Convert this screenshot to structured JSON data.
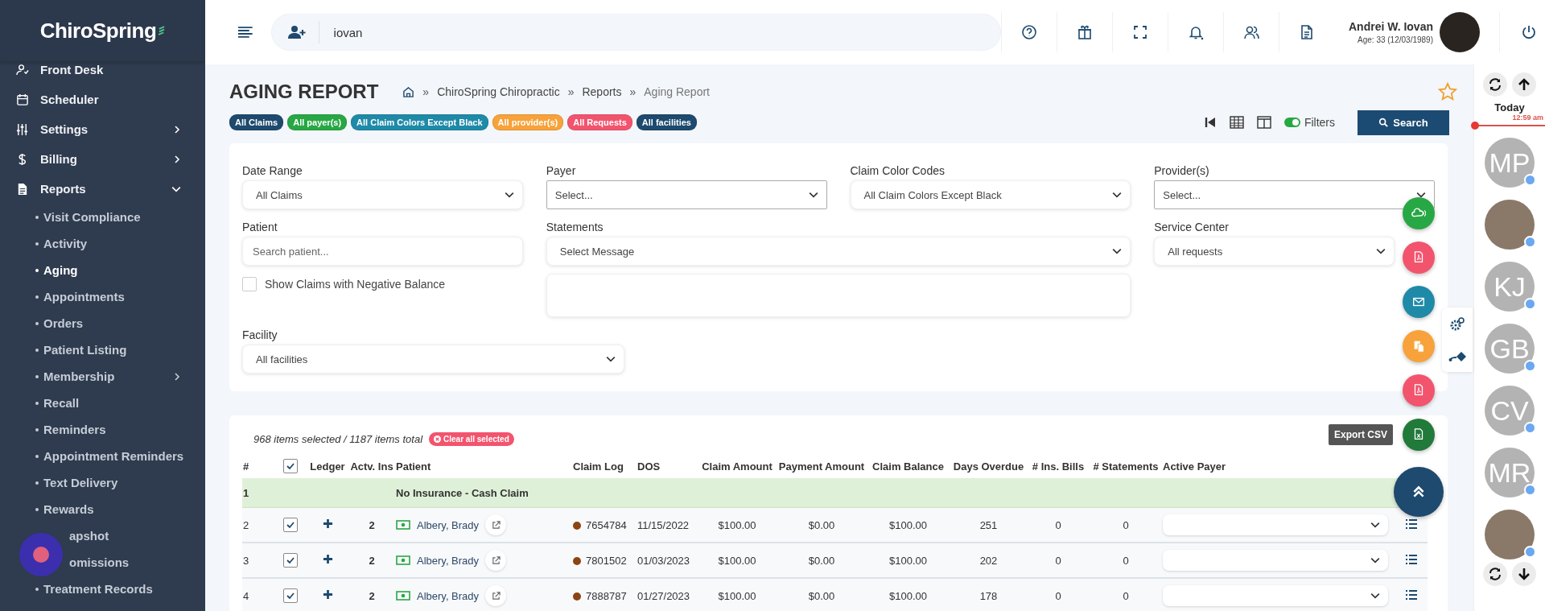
{
  "sidebar": {
    "logo": "ChiroSpring",
    "items": [
      {
        "label": "Front Desk"
      },
      {
        "label": "Scheduler"
      },
      {
        "label": "Settings",
        "expanded": false
      },
      {
        "label": "Billing",
        "expanded": false
      },
      {
        "label": "Reports",
        "expanded": true,
        "children": [
          {
            "label": "Visit Compliance",
            "selected": false,
            "covered": false
          },
          {
            "label": "Activity",
            "selected": false,
            "covered": false
          },
          {
            "label": "Aging",
            "selected": true,
            "covered": false
          },
          {
            "label": "Appointments",
            "selected": false,
            "covered": false
          },
          {
            "label": "Orders",
            "selected": false,
            "covered": false
          },
          {
            "label": "Patient Listing",
            "selected": false,
            "covered": false
          },
          {
            "label": "Membership",
            "selected": false,
            "covered": false,
            "expanded": false
          },
          {
            "label": "Recall",
            "selected": false,
            "covered": false
          },
          {
            "label": "Reminders",
            "selected": false,
            "covered": false
          },
          {
            "label": "Appointment Reminders",
            "selected": false,
            "covered": false
          },
          {
            "label": "Text Delivery",
            "selected": false,
            "covered": false
          },
          {
            "label": "Rewards",
            "selected": false,
            "covered": false
          },
          {
            "label": "apshot",
            "selected": false,
            "covered": true
          },
          {
            "label": "omissions",
            "selected": false,
            "covered": true
          },
          {
            "label": "Treatment Records",
            "selected": false,
            "covered": false
          }
        ]
      }
    ]
  },
  "topbar": {
    "search_value": "iovan",
    "user_name": "Andrei W. Iovan",
    "user_age": "Age: 33 (12/03/1989)"
  },
  "page": {
    "title": "AGING REPORT",
    "breadcrumb_separator": "»",
    "breadcrumbs": [
      "ChiroSpring Chiropractic",
      "Reports",
      "Aging Report"
    ],
    "favorite": false,
    "chips": [
      {
        "label": "All Claims",
        "color": "#1d4a6e"
      },
      {
        "label": "All payer(s)",
        "color": "#28a745"
      },
      {
        "label": "All Claim Colors Except Black",
        "color": "#1f8aa8"
      },
      {
        "label": "All provider(s)",
        "color": "#f7a23b"
      },
      {
        "label": "All Requests",
        "color": "#f2546e"
      },
      {
        "label": "All facilities",
        "color": "#1d4a6e"
      }
    ],
    "filters_toggle": {
      "label": "Filters",
      "on": true
    },
    "search_button": "Search"
  },
  "filters": {
    "date_range": {
      "label": "Date Range",
      "value": "All Claims"
    },
    "payer": {
      "label": "Payer",
      "value": "Select..."
    },
    "claim_color_codes": {
      "label": "Claim Color Codes",
      "value": "All Claim Colors Except Black"
    },
    "providers": {
      "label": "Provider(s)",
      "value": "Select..."
    },
    "patient": {
      "label": "Patient",
      "placeholder": "Search patient..."
    },
    "statements": {
      "label": "Statements",
      "value": "Select Message"
    },
    "service_center": {
      "label": "Service Center",
      "value": "All requests"
    },
    "negative_balance": {
      "label": "Show Claims with Negative Balance",
      "checked": false
    },
    "facility": {
      "label": "Facility",
      "value": "All facilities"
    }
  },
  "table": {
    "summary": "968 items selected / 1187 items total",
    "clear_button": "Clear all selected",
    "export_tooltip": "Export CSV",
    "all_checked": true,
    "columns": [
      "#",
      "Ledger",
      "Actv. Ins",
      "Patient",
      "Claim Log",
      "DOS",
      "Claim Amount",
      "Payment Amount",
      "Claim Balance",
      "Days Overdue",
      "# Ins. Bills",
      "# Statements",
      "Active Payer"
    ],
    "group_row": {
      "number": "1",
      "label": "No Insurance - Cash Claim"
    },
    "rows": [
      {
        "number": "2",
        "checked": true,
        "actv_ins": "2",
        "patient": "Albery, Brady",
        "claim_log": "7654784",
        "color": "#8b4513",
        "dos": "11/15/2022",
        "claim_amount": "$100.00",
        "payment_amount": "$0.00",
        "claim_balance": "$100.00",
        "days_overdue": "251",
        "ins_bills": "0",
        "statements": "0"
      },
      {
        "number": "3",
        "checked": true,
        "actv_ins": "2",
        "patient": "Albery, Brady",
        "claim_log": "7801502",
        "color": "#8b4513",
        "dos": "01/03/2023",
        "claim_amount": "$100.00",
        "payment_amount": "$0.00",
        "claim_balance": "$100.00",
        "days_overdue": "202",
        "ins_bills": "0",
        "statements": "0"
      },
      {
        "number": "4",
        "checked": true,
        "actv_ins": "2",
        "patient": "Albery, Brady",
        "claim_log": "7888787",
        "color": "#8b4513",
        "dos": "01/27/2023",
        "claim_amount": "$100.00",
        "payment_amount": "$0.00",
        "claim_balance": "$100.00",
        "days_overdue": "178",
        "ins_bills": "0",
        "statements": "0"
      }
    ]
  },
  "right_panel": {
    "today": "Today",
    "time": "12:59 am",
    "users": [
      {
        "kind": "initials",
        "initials": "MP"
      },
      {
        "kind": "photo"
      },
      {
        "kind": "initials",
        "initials": "KJ"
      },
      {
        "kind": "initials",
        "initials": "GB"
      },
      {
        "kind": "initials",
        "initials": "CV"
      },
      {
        "kind": "initials",
        "initials": "MR"
      },
      {
        "kind": "photo"
      }
    ]
  }
}
